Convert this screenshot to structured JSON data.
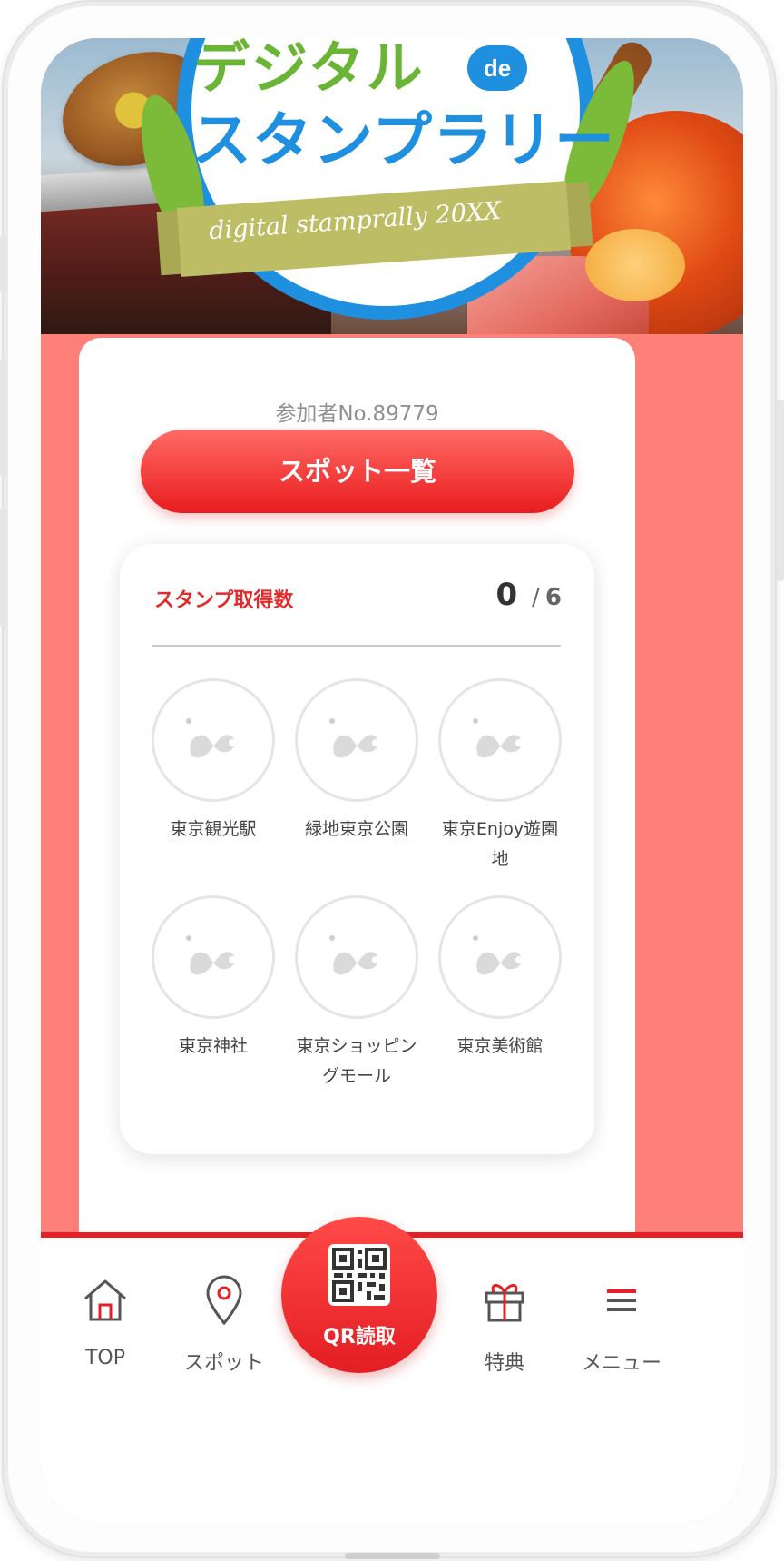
{
  "banner": {
    "title_line1": "デジタル",
    "de_badge": "de",
    "title_line2": "スタンプラリー",
    "ribbon_text": "digital stamprally 20XX"
  },
  "participant": {
    "label": "参加者No.89779"
  },
  "spot_list_button": {
    "label": "スポット一覧"
  },
  "stamps": {
    "title": "スタンプ取得数",
    "acquired": "0",
    "separator": "/",
    "total": "6",
    "items": [
      {
        "label": "東京観光駅"
      },
      {
        "label": "緑地東京公園"
      },
      {
        "label": "東京Enjoy遊園地"
      },
      {
        "label": "東京神社"
      },
      {
        "label": "東京ショッピングモール"
      },
      {
        "label": "東京美術館"
      }
    ]
  },
  "bottom_nav": {
    "items": [
      {
        "label": "TOP",
        "icon": "home-icon"
      },
      {
        "label": "スポット",
        "icon": "map-pin-icon"
      },
      {
        "label": "QR読取",
        "icon": "qr-code-icon"
      },
      {
        "label": "特典",
        "icon": "gift-icon"
      },
      {
        "label": "メニュー",
        "icon": "hamburger-menu-icon"
      }
    ]
  },
  "colors": {
    "background": "#ff7f79",
    "accent_red": "#e62024",
    "stamp_title_red": "#e42a2a",
    "banner_blue": "#1f8fe0",
    "banner_green": "#6ab535"
  }
}
